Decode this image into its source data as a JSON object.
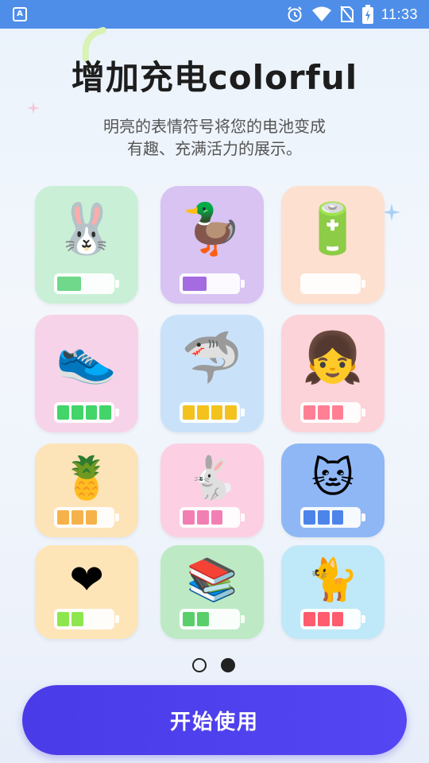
{
  "status_bar": {
    "app_icon_text": "A",
    "time": "11:33"
  },
  "header": {
    "title": "增加充电colorful",
    "subtitle_line1": "明亮的表情符号将您的电池变成",
    "subtitle_line2": "有趣、充满活力的展示。"
  },
  "themes": [
    {
      "id": "bunny",
      "emoji": "🐰",
      "bg": "#c9f0d6",
      "fill": "#6fd88a",
      "segments": 1
    },
    {
      "id": "duck",
      "emoji": "🦆",
      "bg": "#d8c3f3",
      "fill": "#a56be0",
      "segments": 1
    },
    {
      "id": "rainbow-battery",
      "emoji": "🔋",
      "bg": "#fde0cf",
      "fill": "#f4a06a",
      "segments": 0
    },
    {
      "id": "duck-sneaker",
      "emoji": "👟",
      "bg": "#f7d3ea",
      "fill": "#43d46a",
      "segments": 4
    },
    {
      "id": "shark",
      "emoji": "🦈",
      "bg": "#c9e2fa",
      "fill": "#f4c21d",
      "segments": 4
    },
    {
      "id": "frog-girl",
      "emoji": "👧",
      "bg": "#fcd3d8",
      "fill": "#ff8095",
      "segments": 3
    },
    {
      "id": "pineapple",
      "emoji": "🍍",
      "bg": "#fde3b8",
      "fill": "#f6b24a",
      "segments": 3
    },
    {
      "id": "pink-bunny",
      "emoji": "🐇",
      "bg": "#fcd0e2",
      "fill": "#f27fb3",
      "segments": 3
    },
    {
      "id": "cat-tea",
      "emoji": "🐱",
      "bg": "#8fb7f5",
      "fill": "#4c84ea",
      "segments": 3
    },
    {
      "id": "heart",
      "emoji": "❤",
      "bg": "#fde5b8",
      "fill": "#8ee64f",
      "segments": 2
    },
    {
      "id": "cat-books",
      "emoji": "📚",
      "bg": "#bdeac4",
      "fill": "#58cf6a",
      "segments": 2
    },
    {
      "id": "white-cat",
      "emoji": "🐈",
      "bg": "#bfe8f8",
      "fill": "#ff5c6e",
      "segments": 3
    }
  ],
  "pager": {
    "current": 2,
    "total": 2
  },
  "start_button": {
    "label": "开始使用"
  }
}
